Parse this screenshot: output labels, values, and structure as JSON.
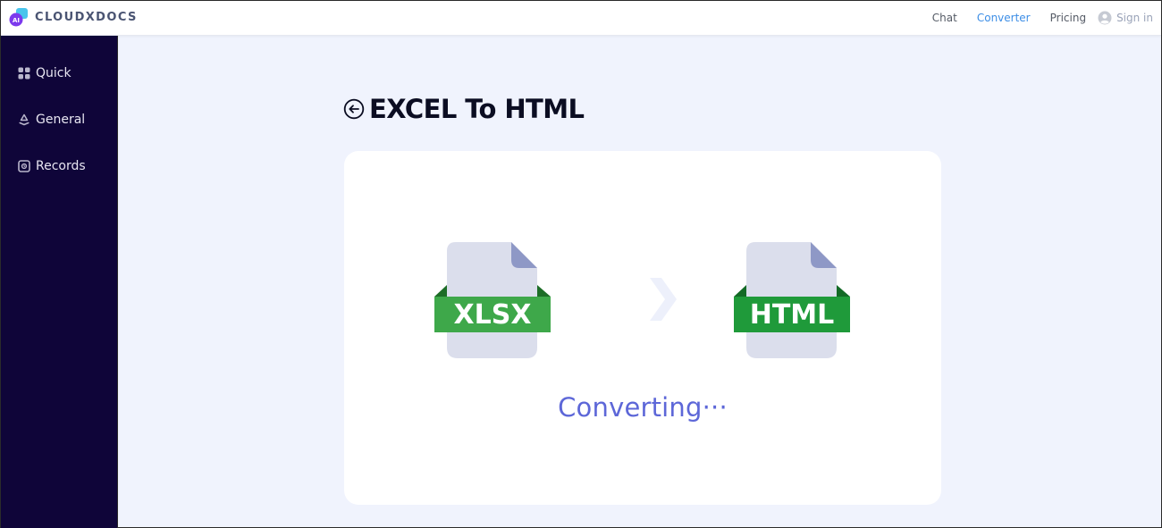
{
  "brand": {
    "name": "CLOUDXDOCS",
    "logo_badge": "AI"
  },
  "nav": {
    "chat": "Chat",
    "converter": "Converter",
    "pricing": "Pricing",
    "signin": "Sign in",
    "active": "Converter"
  },
  "sidebar": {
    "items": [
      {
        "label": "Quick",
        "icon": "grid-icon"
      },
      {
        "label": "General",
        "icon": "recycle-icon"
      },
      {
        "label": "Records",
        "icon": "records-icon"
      }
    ]
  },
  "page": {
    "title": "EXCEL To HTML"
  },
  "conversion": {
    "source_format": "XLSX",
    "target_format": "HTML",
    "status": "Converting···"
  },
  "colors": {
    "sidebar_bg": "#0f0539",
    "accent": "#3d8ee6",
    "status_text": "#5d67d8",
    "file_band_xlsx": "#3ea84a",
    "file_band_html": "#1f9a3a",
    "page_bg": "#f0f3fd"
  }
}
